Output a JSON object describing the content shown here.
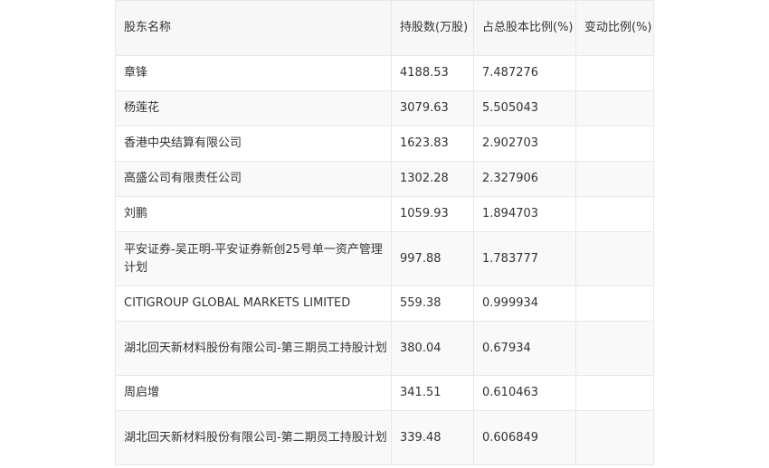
{
  "table": {
    "headers": {
      "name": "股东名称",
      "shares": "持股数(万股)",
      "ratio": "占总股本比例(%)",
      "change": "变动比例(%)"
    },
    "rows": [
      {
        "name": "章锋",
        "shares": "4188.53",
        "ratio": "7.487276",
        "change": ""
      },
      {
        "name": "杨莲花",
        "shares": "3079.63",
        "ratio": "5.505043",
        "change": ""
      },
      {
        "name": "香港中央结算有限公司",
        "shares": "1623.83",
        "ratio": "2.902703",
        "change": ""
      },
      {
        "name": "高盛公司有限责任公司",
        "shares": "1302.28",
        "ratio": "2.327906",
        "change": ""
      },
      {
        "name": "刘鹏",
        "shares": "1059.93",
        "ratio": "1.894703",
        "change": ""
      },
      {
        "name": "平安证券-吴正明-平安证券新创25号单一资产管理计划",
        "shares": "997.88",
        "ratio": "1.783777",
        "change": ""
      },
      {
        "name": "CITIGROUP GLOBAL MARKETS LIMITED",
        "shares": "559.38",
        "ratio": "0.999934",
        "change": ""
      },
      {
        "name": "湖北回天新材料股份有限公司-第三期员工持股计划",
        "shares": "380.04",
        "ratio": "0.67934",
        "change": ""
      },
      {
        "name": "周启增",
        "shares": "341.51",
        "ratio": "0.610463",
        "change": ""
      },
      {
        "name": "湖北回天新材料股份有限公司-第二期员工持股计划",
        "shares": "339.48",
        "ratio": "0.606849",
        "change": ""
      }
    ]
  }
}
